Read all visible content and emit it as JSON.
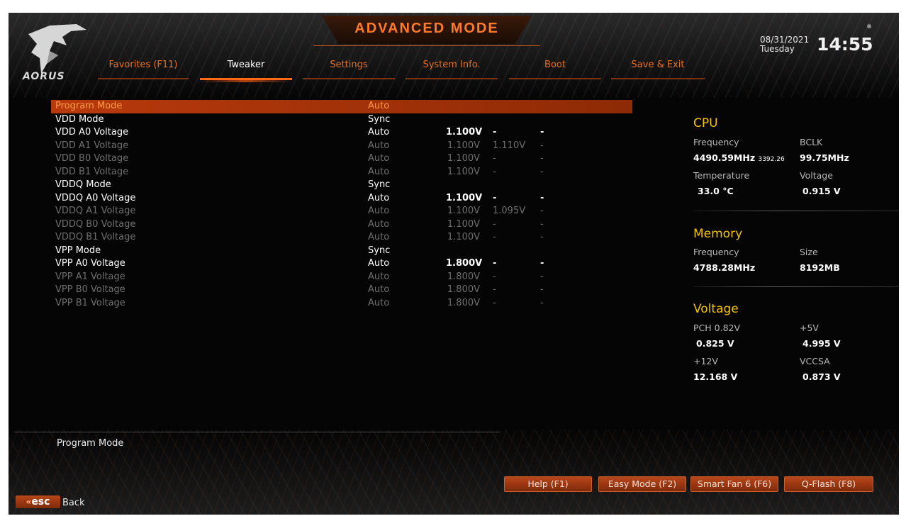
{
  "header": {
    "title": "ADVANCED MODE",
    "logo_text": "AORUS",
    "date": "08/31/2021",
    "day": "Tuesday",
    "time": "14:55"
  },
  "tabs": [
    {
      "label": "Favorites (F11)",
      "active": false
    },
    {
      "label": "Tweaker",
      "active": true
    },
    {
      "label": "Settings",
      "active": false
    },
    {
      "label": "System Info.",
      "active": false
    },
    {
      "label": "Boot",
      "active": false
    },
    {
      "label": "Save & Exit",
      "active": false
    }
  ],
  "settings": [
    {
      "name": "Program Mode",
      "value": "Auto",
      "volt": "",
      "c2": "",
      "c3": "",
      "state": "selected"
    },
    {
      "name": "VDD Mode",
      "value": "Sync",
      "volt": "",
      "c2": "",
      "c3": "",
      "state": "enabled"
    },
    {
      "name": "VDD A0 Voltage",
      "value": "Auto",
      "volt": "1.100V",
      "c2": "-",
      "c3": "-",
      "state": "enabled"
    },
    {
      "name": "VDD A1 Voltage",
      "value": "Auto",
      "volt": "1.100V",
      "c2": "1.110V",
      "c3": "-",
      "state": "disabled"
    },
    {
      "name": "VDD B0 Voltage",
      "value": "Auto",
      "volt": "1.100V",
      "c2": "-",
      "c3": "-",
      "state": "disabled"
    },
    {
      "name": "VDD B1 Voltage",
      "value": "Auto",
      "volt": "1.100V",
      "c2": "-",
      "c3": "-",
      "state": "disabled"
    },
    {
      "name": "VDDQ Mode",
      "value": "Sync",
      "volt": "",
      "c2": "",
      "c3": "",
      "state": "enabled"
    },
    {
      "name": "VDDQ A0 Voltage",
      "value": "Auto",
      "volt": "1.100V",
      "c2": "-",
      "c3": "-",
      "state": "enabled"
    },
    {
      "name": "VDDQ A1 Voltage",
      "value": "Auto",
      "volt": "1.100V",
      "c2": "1.095V",
      "c3": "-",
      "state": "disabled"
    },
    {
      "name": "VDDQ B0 Voltage",
      "value": "Auto",
      "volt": "1.100V",
      "c2": "-",
      "c3": "-",
      "state": "disabled"
    },
    {
      "name": "VDDQ B1 Voltage",
      "value": "Auto",
      "volt": "1.100V",
      "c2": "-",
      "c3": "-",
      "state": "disabled"
    },
    {
      "name": "VPP Mode",
      "value": "Sync",
      "volt": "",
      "c2": "",
      "c3": "",
      "state": "enabled"
    },
    {
      "name": "VPP A0 Voltage",
      "value": "Auto",
      "volt": "1.800V",
      "c2": "-",
      "c3": "-",
      "state": "enabled"
    },
    {
      "name": "VPP A1 Voltage",
      "value": "Auto",
      "volt": "1.800V",
      "c2": "-",
      "c3": "-",
      "state": "disabled"
    },
    {
      "name": "VPP B0 Voltage",
      "value": "Auto",
      "volt": "1.800V",
      "c2": "-",
      "c3": "-",
      "state": "disabled"
    },
    {
      "name": "VPP B1 Voltage",
      "value": "Auto",
      "volt": "1.800V",
      "c2": "-",
      "c3": "-",
      "state": "disabled"
    }
  ],
  "description": "Program Mode",
  "panel": {
    "cpu": {
      "title": "CPU",
      "freq_label": "Frequency",
      "freq_value": "4490.59MHz",
      "freq_sub": "3392.26",
      "bclk_label": "BCLK",
      "bclk_value": "99.75MHz",
      "temp_label": "Temperature",
      "temp_value": "33.0 °C",
      "volt_label": "Voltage",
      "volt_value": "0.915 V"
    },
    "memory": {
      "title": "Memory",
      "freq_label": "Frequency",
      "freq_value": "4788.28MHz",
      "size_label": "Size",
      "size_value": "8192MB"
    },
    "voltage": {
      "title": "Voltage",
      "pch_label": "PCH 0.82V",
      "pch_value": "0.825 V",
      "v5_label": "+5V",
      "v5_value": "4.995 V",
      "v12_label": "+12V",
      "v12_value": "12.168 V",
      "vccsa_label": "VCCSA",
      "vccsa_value": "0.873 V"
    }
  },
  "footer": {
    "buttons": [
      "Help (F1)",
      "Easy Mode (F2)",
      "Smart Fan 6 (F6)",
      "Q-Flash (F8)"
    ],
    "esc_key": "esc",
    "esc_label": "Back"
  },
  "colors": {
    "accent": "#ff6a1a",
    "section_title": "#f2c200",
    "selected_row": "#b83a0c"
  }
}
